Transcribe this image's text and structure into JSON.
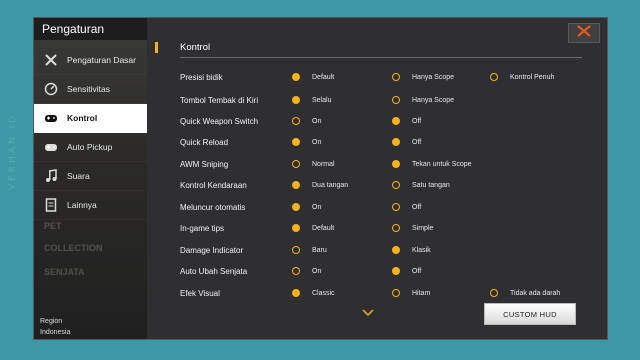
{
  "app": {
    "title": "Pengaturan"
  },
  "watermark": "VERHAN.ID",
  "sidebar": {
    "items": [
      {
        "label": "Pengaturan Dasar",
        "icon": "tools-icon"
      },
      {
        "label": "Sensitivitas",
        "icon": "gauge-icon"
      },
      {
        "label": "Kontrol",
        "icon": "gamepad-icon",
        "active": true
      },
      {
        "label": "Auto Pickup",
        "icon": "gamepad-icon"
      },
      {
        "label": "Suara",
        "icon": "music-note-icon"
      },
      {
        "label": "Lainnya",
        "icon": "document-icon"
      }
    ],
    "region_label": "Region",
    "region_value": "Indonesia"
  },
  "section": {
    "title": "Kontrol"
  },
  "settings": [
    {
      "label": "Presisi bidik",
      "options": [
        {
          "text": "Default",
          "selected": true
        },
        {
          "text": "Hanya Scope",
          "selected": false
        },
        {
          "text": "Kontrol Penuh",
          "selected": false
        }
      ]
    },
    {
      "label": "Tombol Tembak di Kiri",
      "options": [
        {
          "text": "Selalu",
          "selected": true
        },
        {
          "text": "Hanya Scope",
          "selected": false
        }
      ]
    },
    {
      "label": "Quick Weapon Switch",
      "options": [
        {
          "text": "On",
          "selected": false
        },
        {
          "text": "Off",
          "selected": true
        }
      ]
    },
    {
      "label": "Quick Reload",
      "options": [
        {
          "text": "On",
          "selected": true
        },
        {
          "text": "Off",
          "selected": true
        }
      ]
    },
    {
      "label": "AWM Sniping",
      "options": [
        {
          "text": "Normal",
          "selected": false
        },
        {
          "text": "Tekan untuk Scope",
          "selected": true
        }
      ]
    },
    {
      "label": "Kontrol Kendaraan",
      "options": [
        {
          "text": "Dua tangan",
          "selected": true
        },
        {
          "text": "Satu tangan",
          "selected": false
        }
      ]
    },
    {
      "label": "Meluncur otomatis",
      "options": [
        {
          "text": "On",
          "selected": true
        },
        {
          "text": "Off",
          "selected": false
        }
      ]
    },
    {
      "label": "In-game tips",
      "options": [
        {
          "text": "Default",
          "selected": true
        },
        {
          "text": "Simple",
          "selected": false
        }
      ]
    },
    {
      "label": "Damage Indicator",
      "options": [
        {
          "text": "Baru",
          "selected": false
        },
        {
          "text": "Klasik",
          "selected": true
        }
      ]
    },
    {
      "label": "Auto Ubah Senjata",
      "options": [
        {
          "text": "On",
          "selected": false
        },
        {
          "text": "Off",
          "selected": true
        }
      ]
    },
    {
      "label": "Efek Visual",
      "options": [
        {
          "text": "Classic",
          "selected": true
        },
        {
          "text": "Hitam",
          "selected": false
        },
        {
          "text": "Tidak ada darah",
          "selected": false
        }
      ]
    }
  ],
  "buttons": {
    "custom_hud": "CUSTOM HUD"
  },
  "colors": {
    "accent": "#f6b21b",
    "close": "#ff5a1f",
    "background": "#3b98a4"
  }
}
